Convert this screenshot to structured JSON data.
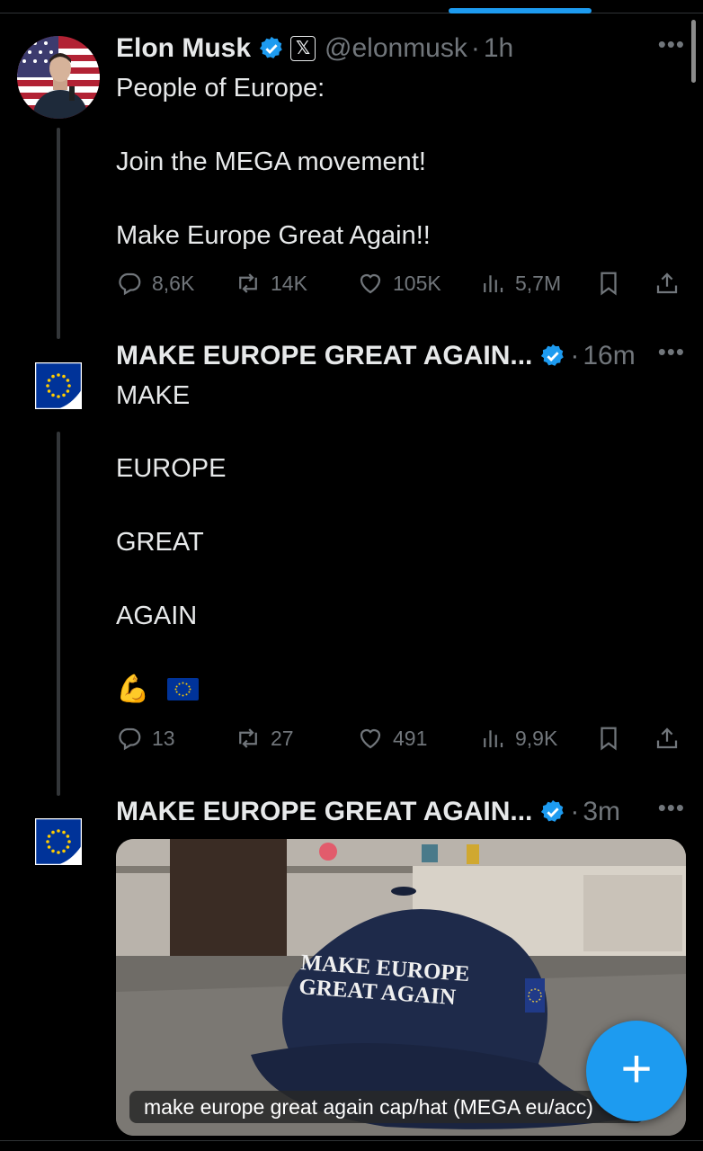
{
  "posts": [
    {
      "name": "Elon Musk",
      "handle": "@elonmusk",
      "time": "1h",
      "lines": [
        "People of Europe:",
        "Join the MEGA movement!",
        "Make Europe Great Again!!"
      ],
      "stats": {
        "replies": "8,6K",
        "reposts": "14K",
        "likes": "105K",
        "views": "5,7M"
      }
    },
    {
      "name": "MAKE EUROPE GREAT AGAIN...",
      "time": "16m",
      "lines": [
        "MAKE",
        "EUROPE",
        "GREAT",
        "AGAIN"
      ],
      "emoji": "💪",
      "stats": {
        "replies": "13",
        "reposts": "27",
        "likes": "491",
        "views": "9,9K"
      }
    },
    {
      "name": "MAKE EUROPE GREAT AGAIN...",
      "time": "3m",
      "media": {
        "cap_text_line1": "MAKE EUROPE",
        "cap_text_line2": "GREAT AGAIN",
        "caption": "make europe great again cap/hat (MEGA eu/acc)"
      }
    }
  ],
  "more_glyph": "•••",
  "fab_label": "+",
  "colors": {
    "accent": "#1d9bf0",
    "muted": "#71767b",
    "text": "#e7e9ea",
    "eu_blue": "#003399",
    "eu_gold": "#ffcc00"
  },
  "icons": [
    "reply-icon",
    "repost-icon",
    "like-icon",
    "views-icon",
    "bookmark-icon",
    "share-icon",
    "verified-icon",
    "more-icon",
    "plus-icon"
  ]
}
